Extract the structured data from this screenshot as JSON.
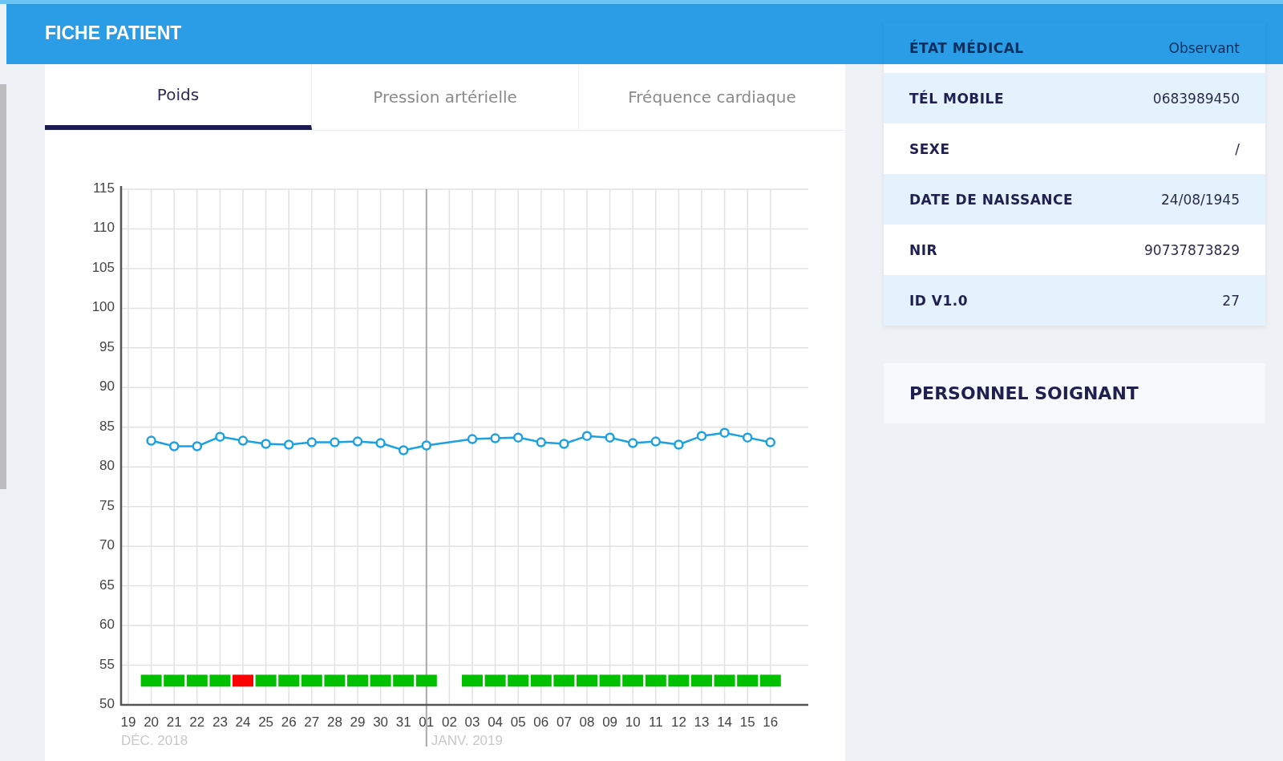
{
  "header": {
    "title": "FICHE PATIENT"
  },
  "tabs": [
    {
      "label": "Poids",
      "selected": true
    },
    {
      "label": "Pression artérielle",
      "selected": false
    },
    {
      "label": "Fréquence cardiaque",
      "selected": false
    }
  ],
  "chart": {
    "chart_data": {
      "type": "line",
      "categories": [
        "19",
        "20",
        "21",
        "22",
        "23",
        "24",
        "25",
        "26",
        "27",
        "28",
        "29",
        "30",
        "31",
        "01",
        "02",
        "03",
        "04",
        "05",
        "06",
        "07",
        "08",
        "09",
        "10",
        "11",
        "12",
        "13",
        "14",
        "15",
        "16"
      ],
      "series": [
        {
          "color": "#1ba1e2",
          "marker": "circle",
          "values": [
            null,
            83.3,
            82.6,
            82.6,
            83.8,
            83.3,
            82.9,
            82.8,
            83.1,
            83.1,
            83.2,
            83.0,
            82.1,
            82.7,
            null,
            83.5,
            83.6,
            83.7,
            83.1,
            82.9,
            83.9,
            83.7,
            83.0,
            83.2,
            82.8,
            83.9,
            84.3,
            83.7,
            83.1
          ]
        }
      ],
      "ylim": [
        50,
        115
      ],
      "grid": true,
      "ref_lines": [
        {
          "axis": "x",
          "value": "01",
          "color": "#a9a9a9"
        }
      ],
      "yticks": [
        50,
        55,
        60,
        65,
        70,
        75,
        80,
        85,
        90,
        95,
        100,
        105,
        110,
        115
      ]
    },
    "month_labels": [
      {
        "text": "DÉC. 2018"
      },
      {
        "text": "JANV. 2019"
      }
    ],
    "day_marks": [
      {
        "present": false
      },
      {
        "color": "#00c000"
      },
      {
        "color": "#00c000"
      },
      {
        "color": "#00c000"
      },
      {
        "color": "#00c000"
      },
      {
        "color": "#ff0000"
      },
      {
        "color": "#00c000"
      },
      {
        "color": "#00c000"
      },
      {
        "color": "#00c000"
      },
      {
        "color": "#00c000"
      },
      {
        "color": "#00c000"
      },
      {
        "color": "#00c000"
      },
      {
        "color": "#00c000"
      },
      {
        "color": "#00c000"
      },
      {
        "present": false
      },
      {
        "color": "#00c000"
      },
      {
        "color": "#00c000"
      },
      {
        "color": "#00c000"
      },
      {
        "color": "#00c000"
      },
      {
        "color": "#00c000"
      },
      {
        "color": "#00c000"
      },
      {
        "color": "#00c000"
      },
      {
        "color": "#00c000"
      },
      {
        "color": "#00c000"
      },
      {
        "color": "#00c000"
      },
      {
        "color": "#00c000"
      },
      {
        "color": "#00c000"
      },
      {
        "color": "#00c000"
      },
      {
        "color": "#00c000"
      }
    ]
  },
  "patient_info": {
    "rows": [
      {
        "label": "ÉTAT MÉDICAL",
        "value": "Observant"
      },
      {
        "label": "TÉL MOBILE",
        "value": "0683989450"
      },
      {
        "label": "SEXE",
        "value": "/"
      },
      {
        "label": "DATE DE NAISSANCE",
        "value": "24/08/1945"
      },
      {
        "label": "NIR",
        "value": "90737873829"
      },
      {
        "label": "ID V1.0",
        "value": "27"
      }
    ]
  },
  "care_staff": {
    "title": "PERSONNEL SOIGNANT"
  }
}
